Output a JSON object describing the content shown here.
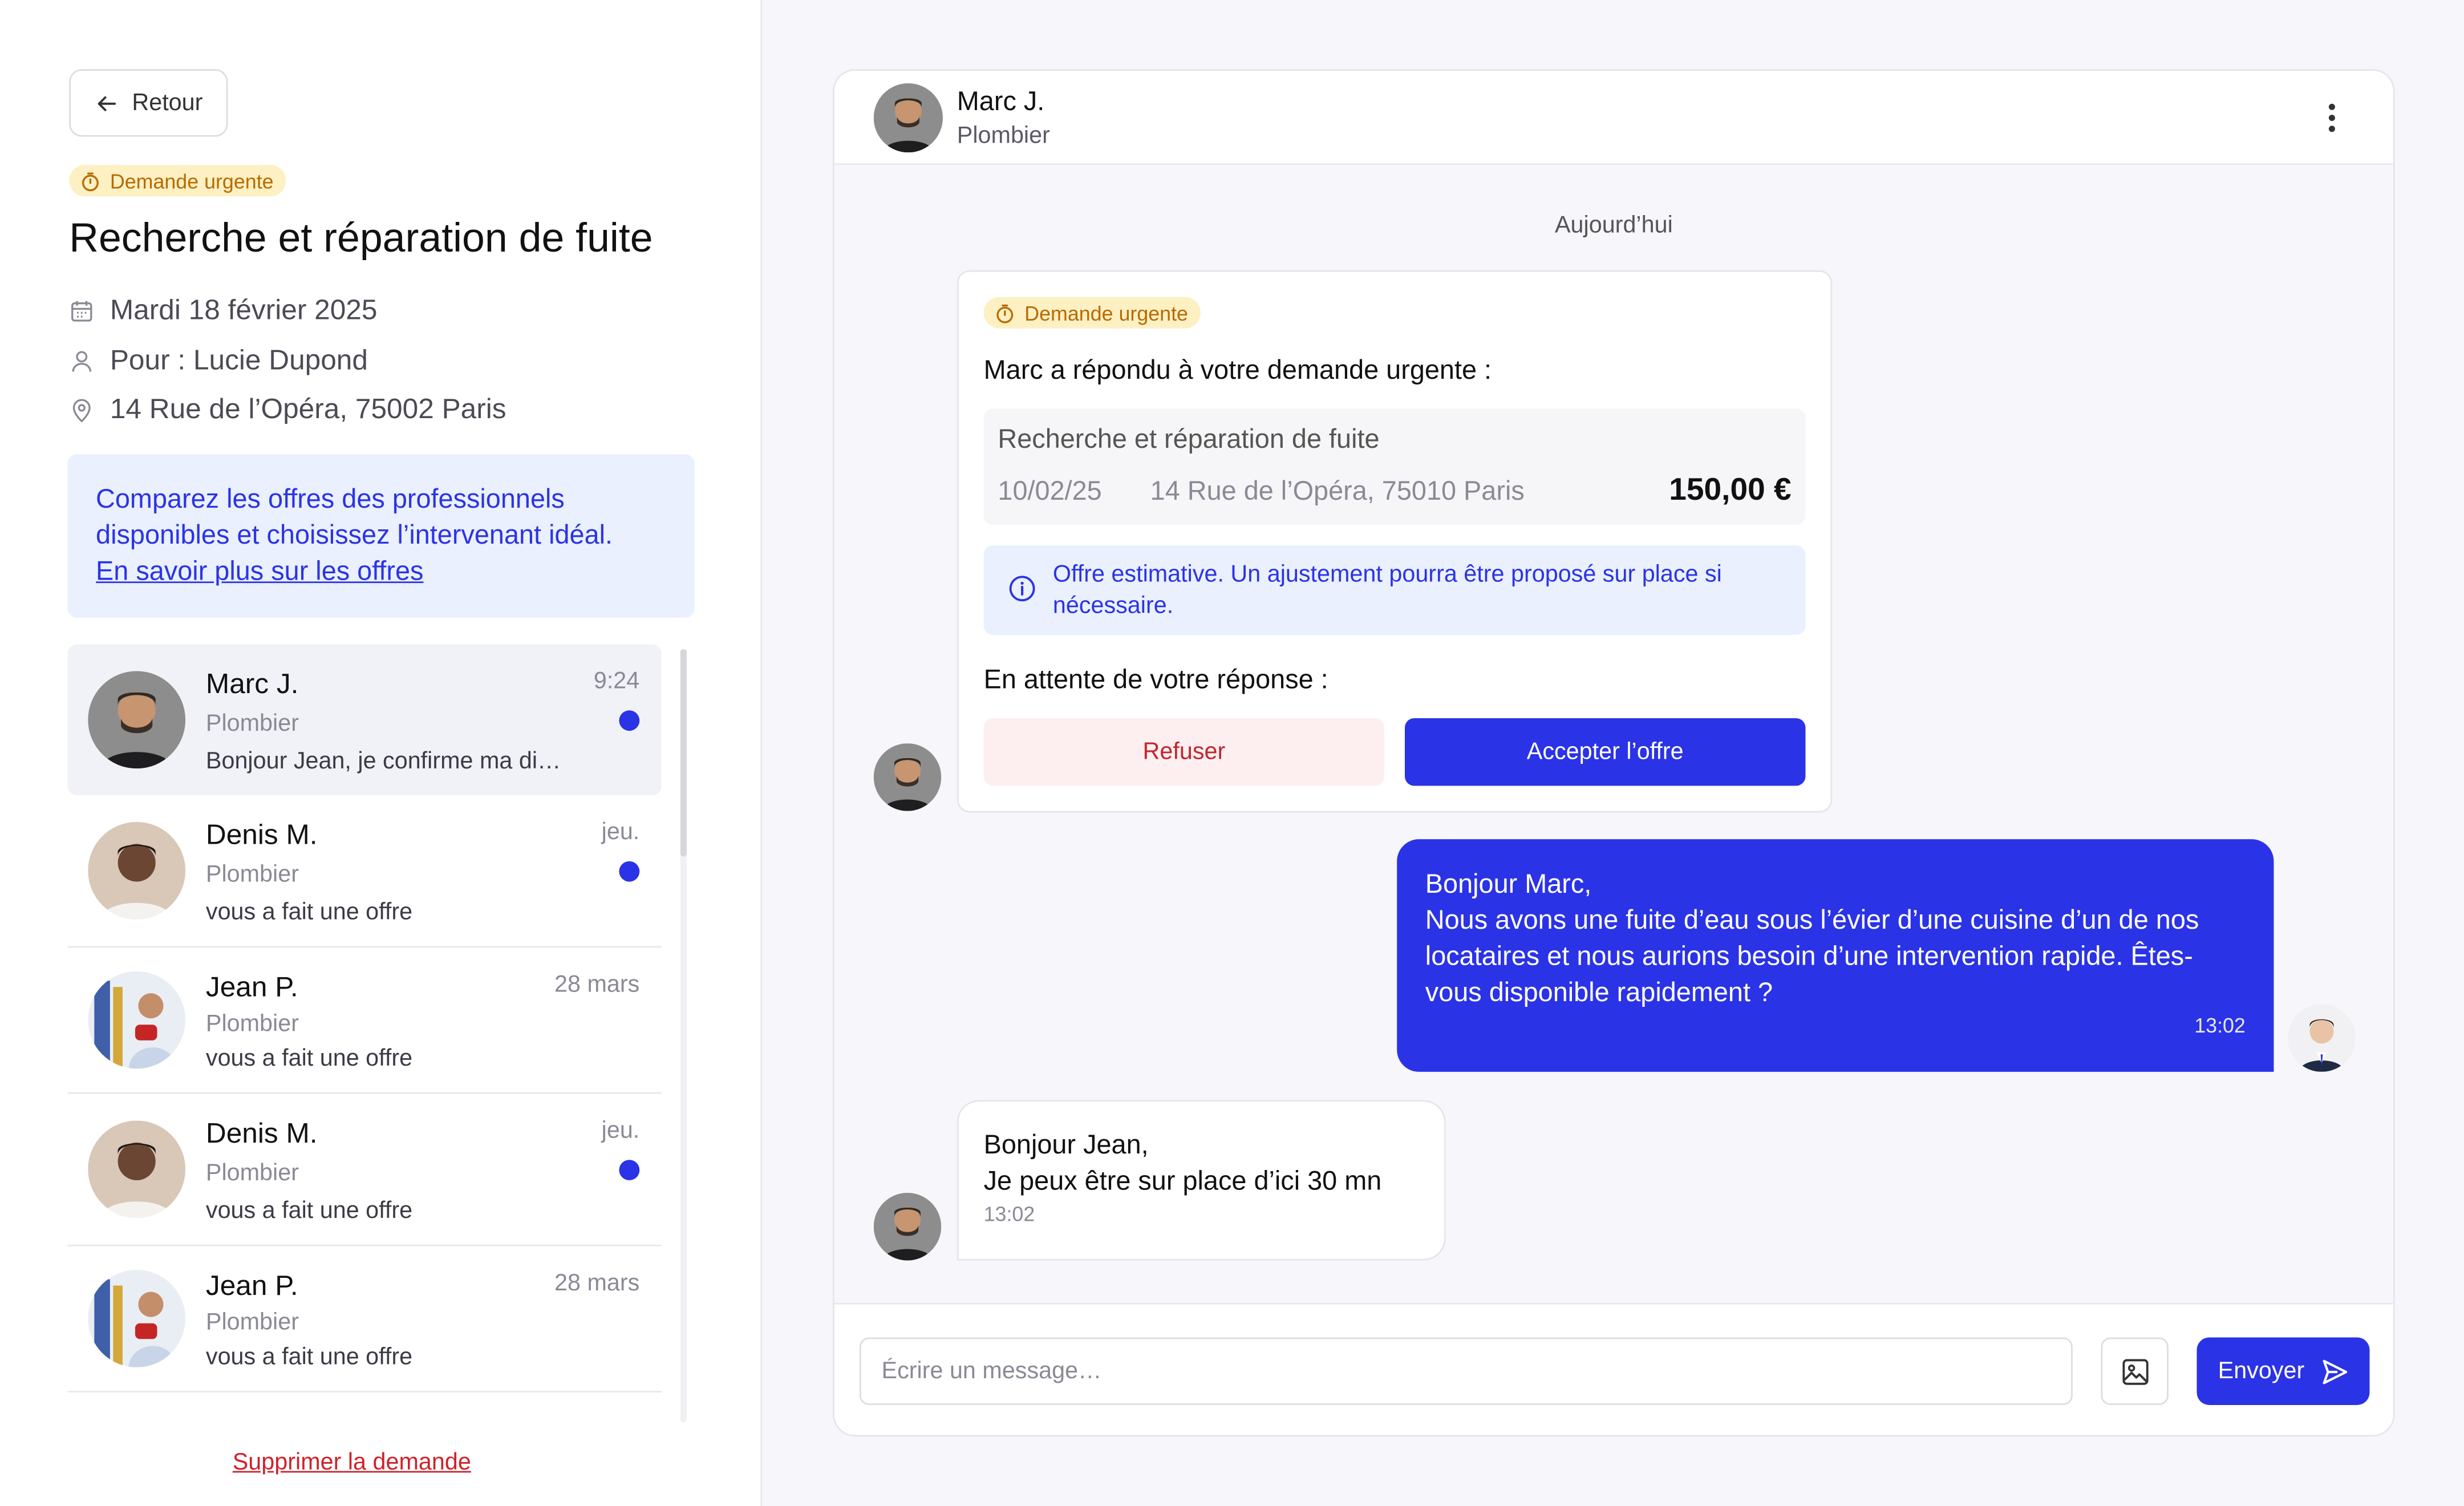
{
  "left": {
    "back_label": "Retour",
    "urgent_badge": "Demande urgente",
    "title": "Recherche et réparation de fuite",
    "date": "Mardi 18 février 2025",
    "for": "Pour : Lucie Dupond",
    "address": "14 Rue de l’Opéra, 75002 Paris",
    "info_text": "Comparez les offres des professionnels disponibles et choisissez l’intervenant idéal.",
    "info_link": "En savoir plus sur les offres",
    "delete_label": "Supprimer la demande"
  },
  "conversations": [
    {
      "name": "Marc J.",
      "role": "Plombier",
      "snippet": "Bonjour Jean, je confirme ma di…",
      "time": "9:24",
      "unread": true
    },
    {
      "name": "Denis M.",
      "role": "Plombier",
      "snippet": "vous a fait une offre",
      "time": "jeu.",
      "unread": true
    },
    {
      "name": "Jean P.",
      "role": "Plombier",
      "snippet": "vous a fait une offre",
      "time": "28 mars",
      "unread": false
    },
    {
      "name": "Denis M.",
      "role": "Plombier",
      "snippet": "vous a fait une offre",
      "time": "jeu.",
      "unread": true
    },
    {
      "name": "Jean P.",
      "role": "Plombier",
      "snippet": "vous a fait une offre",
      "time": "28 mars",
      "unread": false
    }
  ],
  "chat": {
    "header_name": "Marc J.",
    "header_role": "Plombier",
    "day_label": "Aujourd’hui",
    "offer": {
      "badge": "Demande urgente",
      "headline": "Marc a répondu à votre demande urgente :",
      "service": "Recherche et réparation de fuite",
      "date": "10/02/25",
      "address": "14 Rue de l’Opéra, 75010 Paris",
      "price": "150,00 €",
      "note": "Offre estimative. Un ajustement pourra être proposé sur place si nécessaire.",
      "awaiting": "En attente de votre réponse :",
      "refuse_label": "Refuser",
      "accept_label": "Accepter l’offre"
    },
    "outgoing": {
      "line1": "Bonjour Marc,",
      "line2": "Nous avons une fuite d’eau sous l’évier d’une cuisine d’un de nos locataires et nous aurions besoin d’une intervention rapide. Êtes-vous disponible rapidement ?",
      "time": "13:02"
    },
    "incoming": {
      "line1": "Bonjour Jean,",
      "line2": "Je peux être sur place d’ici 30 mn",
      "time": "13:02"
    },
    "composer": {
      "placeholder": "Écrire un message…",
      "send_label": "Envoyer"
    }
  },
  "colors": {
    "accent": "#2b33e6",
    "urgent_bg": "#fdf0c2",
    "urgent_fg": "#b76b00",
    "danger": "#d0212a"
  }
}
